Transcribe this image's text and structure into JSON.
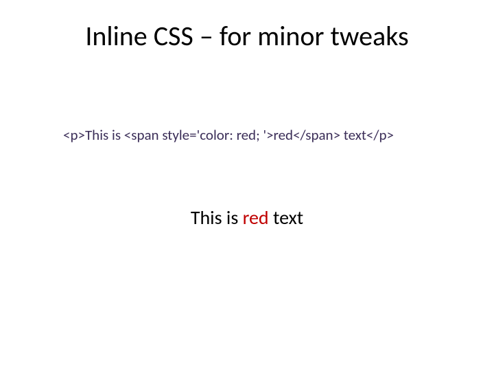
{
  "title": "Inline CSS – for minor tweaks",
  "code": "<p>This is <span style='color: red; '>red</span> text</p>",
  "output": {
    "before": "This is ",
    "red": "red",
    "after": " text"
  }
}
